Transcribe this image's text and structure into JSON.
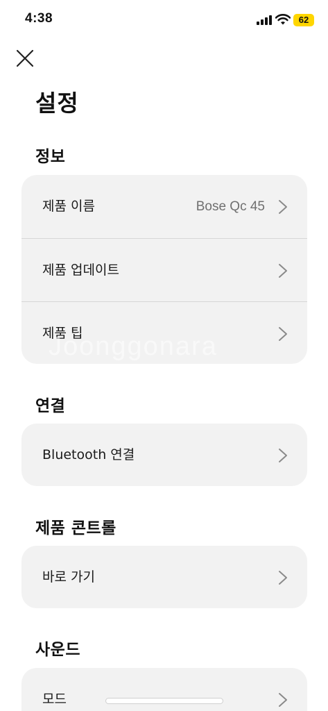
{
  "status_bar": {
    "time": "4:38",
    "battery": "62"
  },
  "page": {
    "title": "설정"
  },
  "sections": {
    "info": {
      "title": "정보",
      "items": [
        {
          "label": "제품 이름",
          "value": "Bose Qc 45"
        },
        {
          "label": "제품 업데이트"
        },
        {
          "label": "제품 팁"
        }
      ]
    },
    "connection": {
      "title": "연결",
      "items": [
        {
          "label": "Bluetooth 연결"
        }
      ]
    },
    "control": {
      "title": "제품 콘트롤",
      "items": [
        {
          "label": "바로 가기"
        }
      ]
    },
    "sound": {
      "title": "사운드",
      "items": [
        {
          "label": "모드"
        }
      ]
    }
  },
  "watermark": "Joonggonara",
  "colors": {
    "battery": "#ffd600",
    "card_bg": "#f2f2f2",
    "value_text": "#6f6f6f"
  }
}
